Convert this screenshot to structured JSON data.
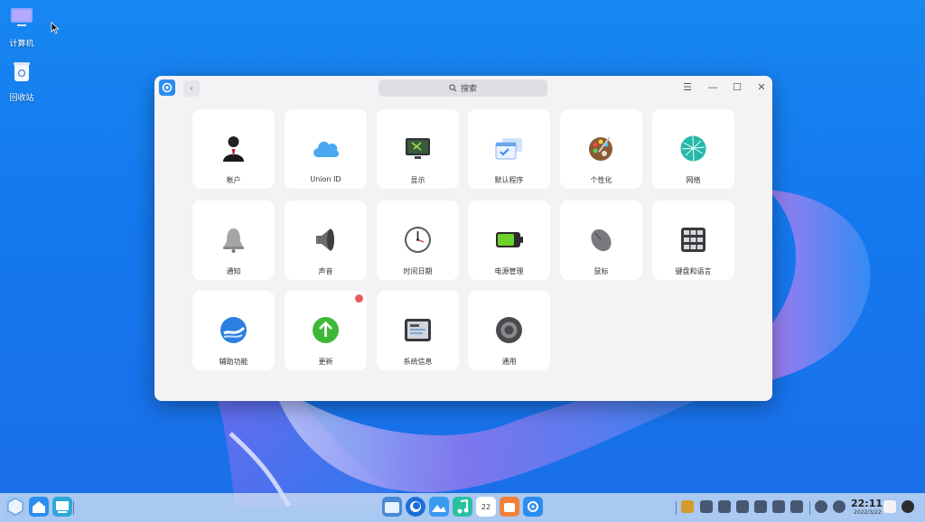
{
  "desktop": {
    "icons": [
      {
        "label": "计算机",
        "icon": "computer-icon"
      },
      {
        "label": "回收站",
        "icon": "trash-icon"
      }
    ]
  },
  "window": {
    "search_placeholder": "搜索",
    "controls": {
      "menu": "☰",
      "minimize": "—",
      "maximize": "☐",
      "close": "✕"
    },
    "back_glyph": "‹"
  },
  "modules": [
    {
      "label": "帐户",
      "icon": "account-icon"
    },
    {
      "label": "Union ID",
      "icon": "cloud-icon"
    },
    {
      "label": "显示",
      "icon": "display-icon"
    },
    {
      "label": "默认程序",
      "icon": "default-apps-icon"
    },
    {
      "label": "个性化",
      "icon": "personalization-icon"
    },
    {
      "label": "网络",
      "icon": "network-icon"
    },
    {
      "label": "通知",
      "icon": "bell-icon"
    },
    {
      "label": "声音",
      "icon": "speaker-icon"
    },
    {
      "label": "时间日期",
      "icon": "clock-icon"
    },
    {
      "label": "电源管理",
      "icon": "battery-icon"
    },
    {
      "label": "鼠标",
      "icon": "mouse-icon"
    },
    {
      "label": "键盘和语言",
      "icon": "keyboard-icon"
    },
    {
      "label": "辅助功能",
      "icon": "accessibility-icon"
    },
    {
      "label": "更新",
      "icon": "update-icon"
    },
    {
      "label": "系统信息",
      "icon": "system-info-icon"
    },
    {
      "label": "通用",
      "icon": "general-icon"
    }
  ],
  "taskbar": {
    "time": "22:11",
    "date": "2022/3/22",
    "calendar_day": "22"
  },
  "colors": {
    "accent": "#2c8df0",
    "badge": "#f05a5a"
  }
}
